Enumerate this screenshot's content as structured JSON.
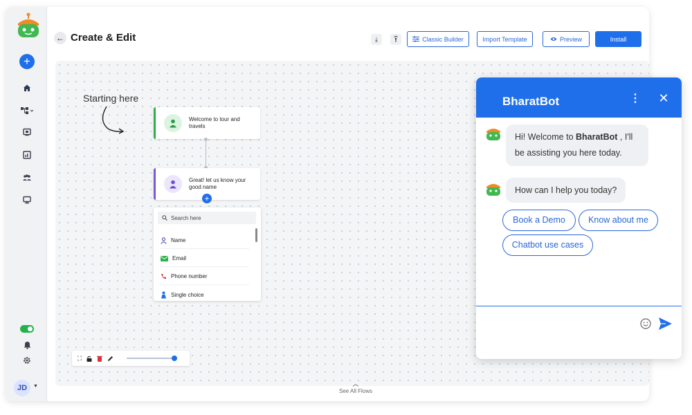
{
  "header": {
    "title": "Create & Edit",
    "buttons": {
      "classic_builder": "Classic Builder",
      "import_template": "Import Template",
      "preview": "Preview",
      "install": "Install"
    }
  },
  "canvas": {
    "start_note": "Starting here",
    "nodes": [
      {
        "text": "Welcome to tour and travels"
      },
      {
        "text": "Great! let us know your good name"
      }
    ],
    "picker": {
      "search_placeholder": "Search here",
      "items": [
        {
          "label": "Name",
          "icon": "person-icon"
        },
        {
          "label": "Email",
          "icon": "email-icon"
        },
        {
          "label": "Phone number",
          "icon": "phone-icon"
        },
        {
          "label": "Single choice",
          "icon": "single-choice-icon"
        }
      ]
    },
    "zoom_level": 1.0,
    "see_all_flows": "See All Flows"
  },
  "sidebar": {
    "avatar_initials": "JD",
    "items": [
      "home-icon",
      "flow-icon",
      "display-icon",
      "chart-icon",
      "users-icon",
      "monitor-icon"
    ],
    "toggle_on": true
  },
  "chat": {
    "title": "BharatBot",
    "messages": [
      {
        "prefix": "Hi! Welcome to ",
        "bold": "BharatBot",
        "suffix": " , I'll",
        "line2": "be assisting you here today."
      },
      {
        "text": "How can I help you today?"
      }
    ],
    "quick_replies": [
      "Book a Demo",
      "Know about me",
      "Chatbot use cases"
    ]
  },
  "colors": {
    "accent": "#1f6feb",
    "node_green": "#2eb04a",
    "node_purple": "#7a5ad6",
    "toggle_green": "#22b14c"
  }
}
